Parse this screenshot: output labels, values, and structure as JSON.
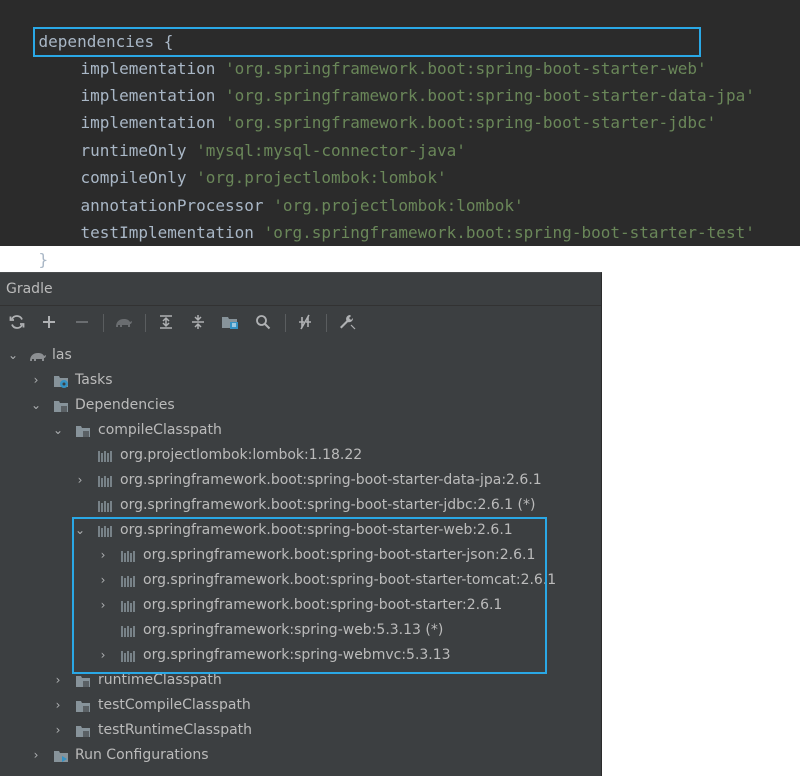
{
  "editor": {
    "lines": [
      {
        "kw": "dependencies {",
        "str": ""
      },
      {
        "kw": "implementation ",
        "str": "'org.springframework.boot:spring-boot-starter-web'"
      },
      {
        "kw": "implementation ",
        "str": "'org.springframework.boot:spring-boot-starter-data-jpa'"
      },
      {
        "kw": "implementation ",
        "str": "'org.springframework.boot:spring-boot-starter-jdbc'"
      },
      {
        "kw": "runtimeOnly ",
        "str": "'mysql:mysql-connector-java'"
      },
      {
        "kw": "compileOnly ",
        "str": "'org.projectlombok:lombok'"
      },
      {
        "kw": "annotationProcessor ",
        "str": "'org.projectlombok:lombok'"
      },
      {
        "kw": "testImplementation ",
        "str": "'org.springframework.boot:spring-boot-starter-test'"
      },
      {
        "kw": "}",
        "str": ""
      }
    ]
  },
  "panel": {
    "title": "Gradle",
    "toolbar": {
      "icons": [
        "refresh-icon",
        "plus-icon",
        "minus-icon",
        "elephant-icon",
        "expand-all-icon",
        "collapse-all-icon",
        "folder-module-icon",
        "search-icon",
        "toggle-offline-icon",
        "wrench-icon"
      ]
    }
  },
  "tree": [
    {
      "label": "las",
      "arrow": "⌄",
      "icon": "elephant-icon"
    },
    {
      "label": "Tasks",
      "arrow": "›",
      "icon": "tasks-folder-icon"
    },
    {
      "label": "Dependencies",
      "arrow": "⌄",
      "icon": "dependencies-folder-icon"
    },
    {
      "label": "compileClasspath",
      "arrow": "⌄",
      "icon": "configuration-folder-icon"
    },
    {
      "label": "org.projectlombok:lombok:1.18.22",
      "arrow": "",
      "icon": "library-icon"
    },
    {
      "label": "org.springframework.boot:spring-boot-starter-data-jpa:2.6.1",
      "arrow": "›",
      "icon": "library-icon"
    },
    {
      "label": "org.springframework.boot:spring-boot-starter-jdbc:2.6.1 (*)",
      "arrow": "",
      "icon": "library-icon"
    },
    {
      "label": "org.springframework.boot:spring-boot-starter-web:2.6.1",
      "arrow": "⌄",
      "icon": "library-icon"
    },
    {
      "label": "org.springframework.boot:spring-boot-starter-json:2.6.1",
      "arrow": "›",
      "icon": "library-icon"
    },
    {
      "label": "org.springframework.boot:spring-boot-starter-tomcat:2.6.1",
      "arrow": "›",
      "icon": "library-icon"
    },
    {
      "label": "org.springframework.boot:spring-boot-starter:2.6.1",
      "arrow": "›",
      "icon": "library-icon"
    },
    {
      "label": "org.springframework:spring-web:5.3.13 (*)",
      "arrow": "",
      "icon": "library-icon"
    },
    {
      "label": "org.springframework:spring-webmvc:5.3.13",
      "arrow": "›",
      "icon": "library-icon"
    },
    {
      "label": "runtimeClasspath",
      "arrow": "›",
      "icon": "configuration-folder-icon"
    },
    {
      "label": "testCompileClasspath",
      "arrow": "›",
      "icon": "configuration-folder-icon"
    },
    {
      "label": "testRuntimeClasspath",
      "arrow": "›",
      "icon": "configuration-folder-icon"
    },
    {
      "label": "Run Configurations",
      "arrow": "›",
      "icon": "run-config-folder-icon"
    }
  ],
  "colors": {
    "editor_bg": "#2b2b2b",
    "panel_bg": "#3c3f41",
    "string_green": "#6a8759",
    "highlight_blue": "#2aa8e6"
  }
}
